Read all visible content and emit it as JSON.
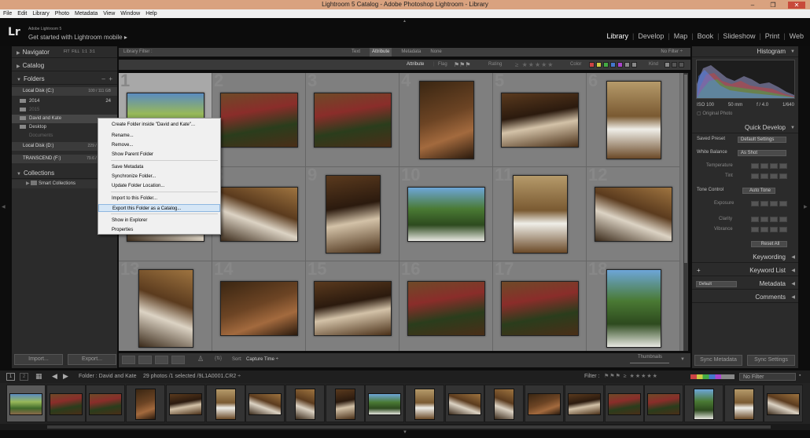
{
  "window": {
    "title": "Lightroom 5 Catalog - Adobe Photoshop Lightroom - Library"
  },
  "menubar": [
    "File",
    "Edit",
    "Library",
    "Photo",
    "Metadata",
    "View",
    "Window",
    "Help"
  ],
  "identity": {
    "logo": "Lr",
    "version": "Adobe Lightroom 5",
    "mobile": "Get started with Lightroom mobile ▸"
  },
  "modules": [
    "Library",
    "Develop",
    "Map",
    "Book",
    "Slideshow",
    "Print",
    "Web"
  ],
  "active_module": "Library",
  "left_panel": {
    "navigator": {
      "label": "Navigator",
      "zoom": [
        "FIT",
        "FILL",
        "1:1",
        "3:1"
      ]
    },
    "catalog": {
      "label": "Catalog"
    },
    "folders": {
      "label": "Folders",
      "volumes": [
        {
          "name": "Local Disk (C:)",
          "size": "100 / 111 GB"
        },
        {
          "name": "Local Disk (D:)",
          "size": "229 / 931 GB"
        },
        {
          "name": "TRANSCEND (F:)",
          "size": "79.6 / 931 GB"
        }
      ],
      "items": [
        {
          "name": "2014",
          "count": "24"
        },
        {
          "name": "2015",
          "count": ""
        },
        {
          "name": "David and Kate",
          "count": ""
        },
        {
          "name": "Desktop",
          "count": ""
        },
        {
          "name": "Documents",
          "count": ""
        }
      ]
    },
    "collections": {
      "label": "Collections",
      "smart": "Smart Collections"
    },
    "import_btn": "Import...",
    "export_btn": "Export..."
  },
  "filter_bar": {
    "title": "Library Filter :",
    "tabs": [
      "Text",
      "Attribute",
      "Metadata",
      "None"
    ],
    "active_tab": "Attribute",
    "preset": "No Filter ÷",
    "attribute_label": "Attribute",
    "flag_label": "Flag",
    "rating_label": "Rating",
    "color_label": "Color",
    "kind_label": "Kind",
    "colors": [
      "#c44",
      "#cc4",
      "#4a4",
      "#47c",
      "#a4c",
      "#888",
      "#888",
      "#888"
    ]
  },
  "grid": {
    "cells": [
      {
        "n": "1",
        "style": "p3"
      },
      {
        "n": "2",
        "style": "p6"
      },
      {
        "n": "3",
        "style": "p6"
      },
      {
        "n": "4",
        "style": "p1"
      },
      {
        "n": "5",
        "style": "p4"
      },
      {
        "n": "6",
        "style": "p5"
      },
      {
        "n": "7",
        "style": "p2"
      },
      {
        "n": "8",
        "style": "p2"
      },
      {
        "n": "9",
        "style": "p4"
      },
      {
        "n": "10",
        "style": "p7"
      },
      {
        "n": "11",
        "style": "p5"
      },
      {
        "n": "12",
        "style": "p2"
      },
      {
        "n": "13",
        "style": "p2"
      },
      {
        "n": "14",
        "style": "p1"
      },
      {
        "n": "15",
        "style": "p4"
      },
      {
        "n": "16",
        "style": "p6"
      },
      {
        "n": "17",
        "style": "p6"
      },
      {
        "n": "18",
        "style": "p7"
      }
    ]
  },
  "grid_toolbar": {
    "sort_label": "Sort:",
    "sort_value": "Capture Time ÷",
    "thumbnails": "Thumbnails"
  },
  "right_panel": {
    "histogram": {
      "label": "Histogram",
      "iso": "ISO 100",
      "focal": "50 mm",
      "aperture": "f / 4.0",
      "shutter": "1/640",
      "original": "Original Photo"
    },
    "quick_develop": {
      "label": "Quick Develop",
      "saved_preset": "Saved Preset",
      "saved_preset_value": "Default Settings",
      "white_balance": "White Balance",
      "white_balance_value": "As Shot",
      "temperature": "Temperature",
      "tint": "Tint",
      "tone_control": "Tone Control",
      "auto_tone": "Auto Tone",
      "exposure": "Exposure",
      "clarity": "Clarity",
      "vibrance": "Vibrance",
      "reset_all": "Reset All"
    },
    "keywording": "Keywording",
    "keyword_list": "Keyword List",
    "metadata": "Metadata",
    "metadata_preset": "Default",
    "comments": "Comments",
    "sync_metadata": "Sync Metadata",
    "sync_settings": "Sync Settings"
  },
  "filmstrip_bar": {
    "folder": "Folder : David and Kate",
    "count": "29 photos /1 selected /9L1A0001.CR2 ÷",
    "filter_label": "Filter :",
    "filter_value": "No Filter"
  },
  "context_menu": {
    "items": [
      {
        "label": "Create Folder inside \"David and Kate\"...",
        "highlighted": false
      },
      {
        "label": "Rename...",
        "highlighted": false
      },
      {
        "label": "Remove...",
        "highlighted": false
      },
      {
        "label": "Show Parent Folder",
        "highlighted": false
      },
      {
        "label": "Save Metadata",
        "highlighted": false
      },
      {
        "label": "Synchronize Folder...",
        "highlighted": false
      },
      {
        "label": "Update Folder Location...",
        "highlighted": false
      },
      {
        "label": "Import to this Folder...",
        "highlighted": false
      },
      {
        "label": "Export this Folder as a Catalog...",
        "highlighted": true
      },
      {
        "label": "Show in Explorer",
        "highlighted": false
      },
      {
        "label": "Properties",
        "highlighted": false
      }
    ]
  }
}
